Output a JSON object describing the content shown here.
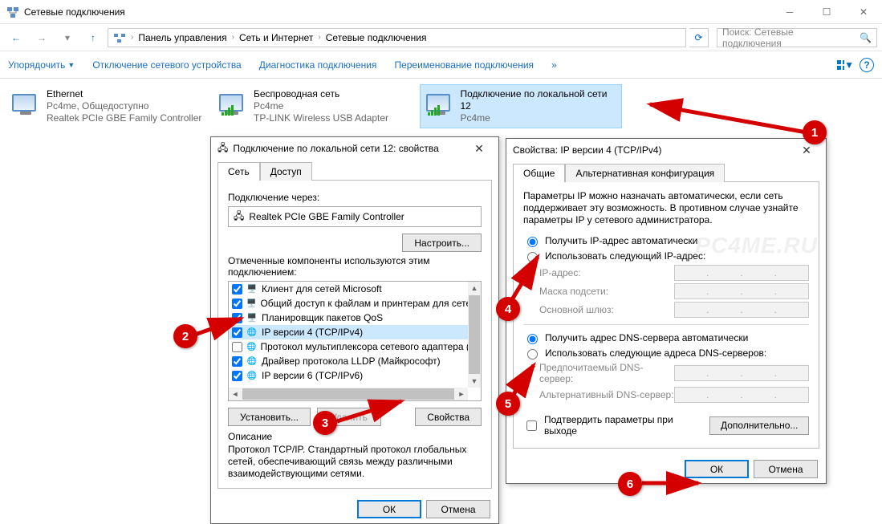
{
  "window": {
    "title": "Сетевые подключения",
    "breadcrumb": [
      "Панель управления",
      "Сеть и Интернет",
      "Сетевые подключения"
    ],
    "search_placeholder": "Поиск: Сетевые подключения"
  },
  "cmdbar": {
    "organize": "Упорядочить",
    "disable": "Отключение сетевого устройства",
    "diagnose": "Диагностика подключения",
    "rename": "Переименование подключения"
  },
  "connections": [
    {
      "name": "Ethernet",
      "status": "Pc4me, Общедоступно",
      "device": "Realtek PCIe GBE Family Controller",
      "selected": false,
      "icon": "ethernet"
    },
    {
      "name": "Беспроводная сеть",
      "status": "Pc4me",
      "device": "TP-LINK Wireless USB Adapter",
      "selected": false,
      "icon": "wifi"
    },
    {
      "name": "Подключение по локальной сети 12",
      "status": "Pc4me",
      "device": "",
      "selected": true,
      "icon": "wifi"
    }
  ],
  "propsDlg": {
    "title": "Подключение по локальной сети 12: свойства",
    "tabs": {
      "net": "Сеть",
      "access": "Доступ"
    },
    "connect_via": "Подключение через:",
    "adapter": "Realtek PCIe GBE Family Controller",
    "configure": "Настроить...",
    "components_label": "Отмеченные компоненты используются этим подключением:",
    "components": [
      {
        "checked": true,
        "label": "Клиент для сетей Microsoft"
      },
      {
        "checked": true,
        "label": "Общий доступ к файлам и принтерам для сетей Mi"
      },
      {
        "checked": true,
        "label": "Планировщик пакетов QoS"
      },
      {
        "checked": true,
        "label": "IP версии 4 (TCP/IPv4)",
        "selected": true
      },
      {
        "checked": false,
        "label": "Протокол мультиплексора сетевого адаптера (Ма"
      },
      {
        "checked": true,
        "label": "Драйвер протокола LLDP (Майкрософт)"
      },
      {
        "checked": true,
        "label": "IP версии 6 (TCP/IPv6)"
      }
    ],
    "install": "Установить...",
    "remove": "Удалить",
    "properties": "Свойства",
    "desc_title": "Описание",
    "desc_text": "Протокол TCP/IP. Стандартный протокол глобальных сетей, обеспечивающий связь между различными взаимодействующими сетями.",
    "ok": "ОК",
    "cancel": "Отмена"
  },
  "ipv4Dlg": {
    "title": "Свойства: IP версии 4 (TCP/IPv4)",
    "tabs": {
      "general": "Общие",
      "alt": "Альтернативная конфигурация"
    },
    "intro": "Параметры IP можно назначать автоматически, если сеть поддерживает эту возможность. В противном случае узнайте параметры IP у сетевого администратора.",
    "ip_auto": "Получить IP-адрес автоматически",
    "ip_manual": "Использовать следующий IP-адрес:",
    "ip_addr": "IP-адрес:",
    "mask": "Маска подсети:",
    "gw": "Основной шлюз:",
    "dns_auto": "Получить адрес DNS-сервера автоматически",
    "dns_manual": "Использовать следующие адреса DNS-серверов:",
    "dns_pref": "Предпочитаемый DNS-сервер:",
    "dns_alt": "Альтернативный DNS-сервер:",
    "validate": "Подтвердить параметры при выходе",
    "advanced": "Дополнительно...",
    "ok": "ОК",
    "cancel": "Отмена"
  },
  "badges": {
    "1": "1",
    "2": "2",
    "3": "3",
    "4": "4",
    "5": "5",
    "6": "6"
  },
  "watermark": "PC4ME.RU"
}
